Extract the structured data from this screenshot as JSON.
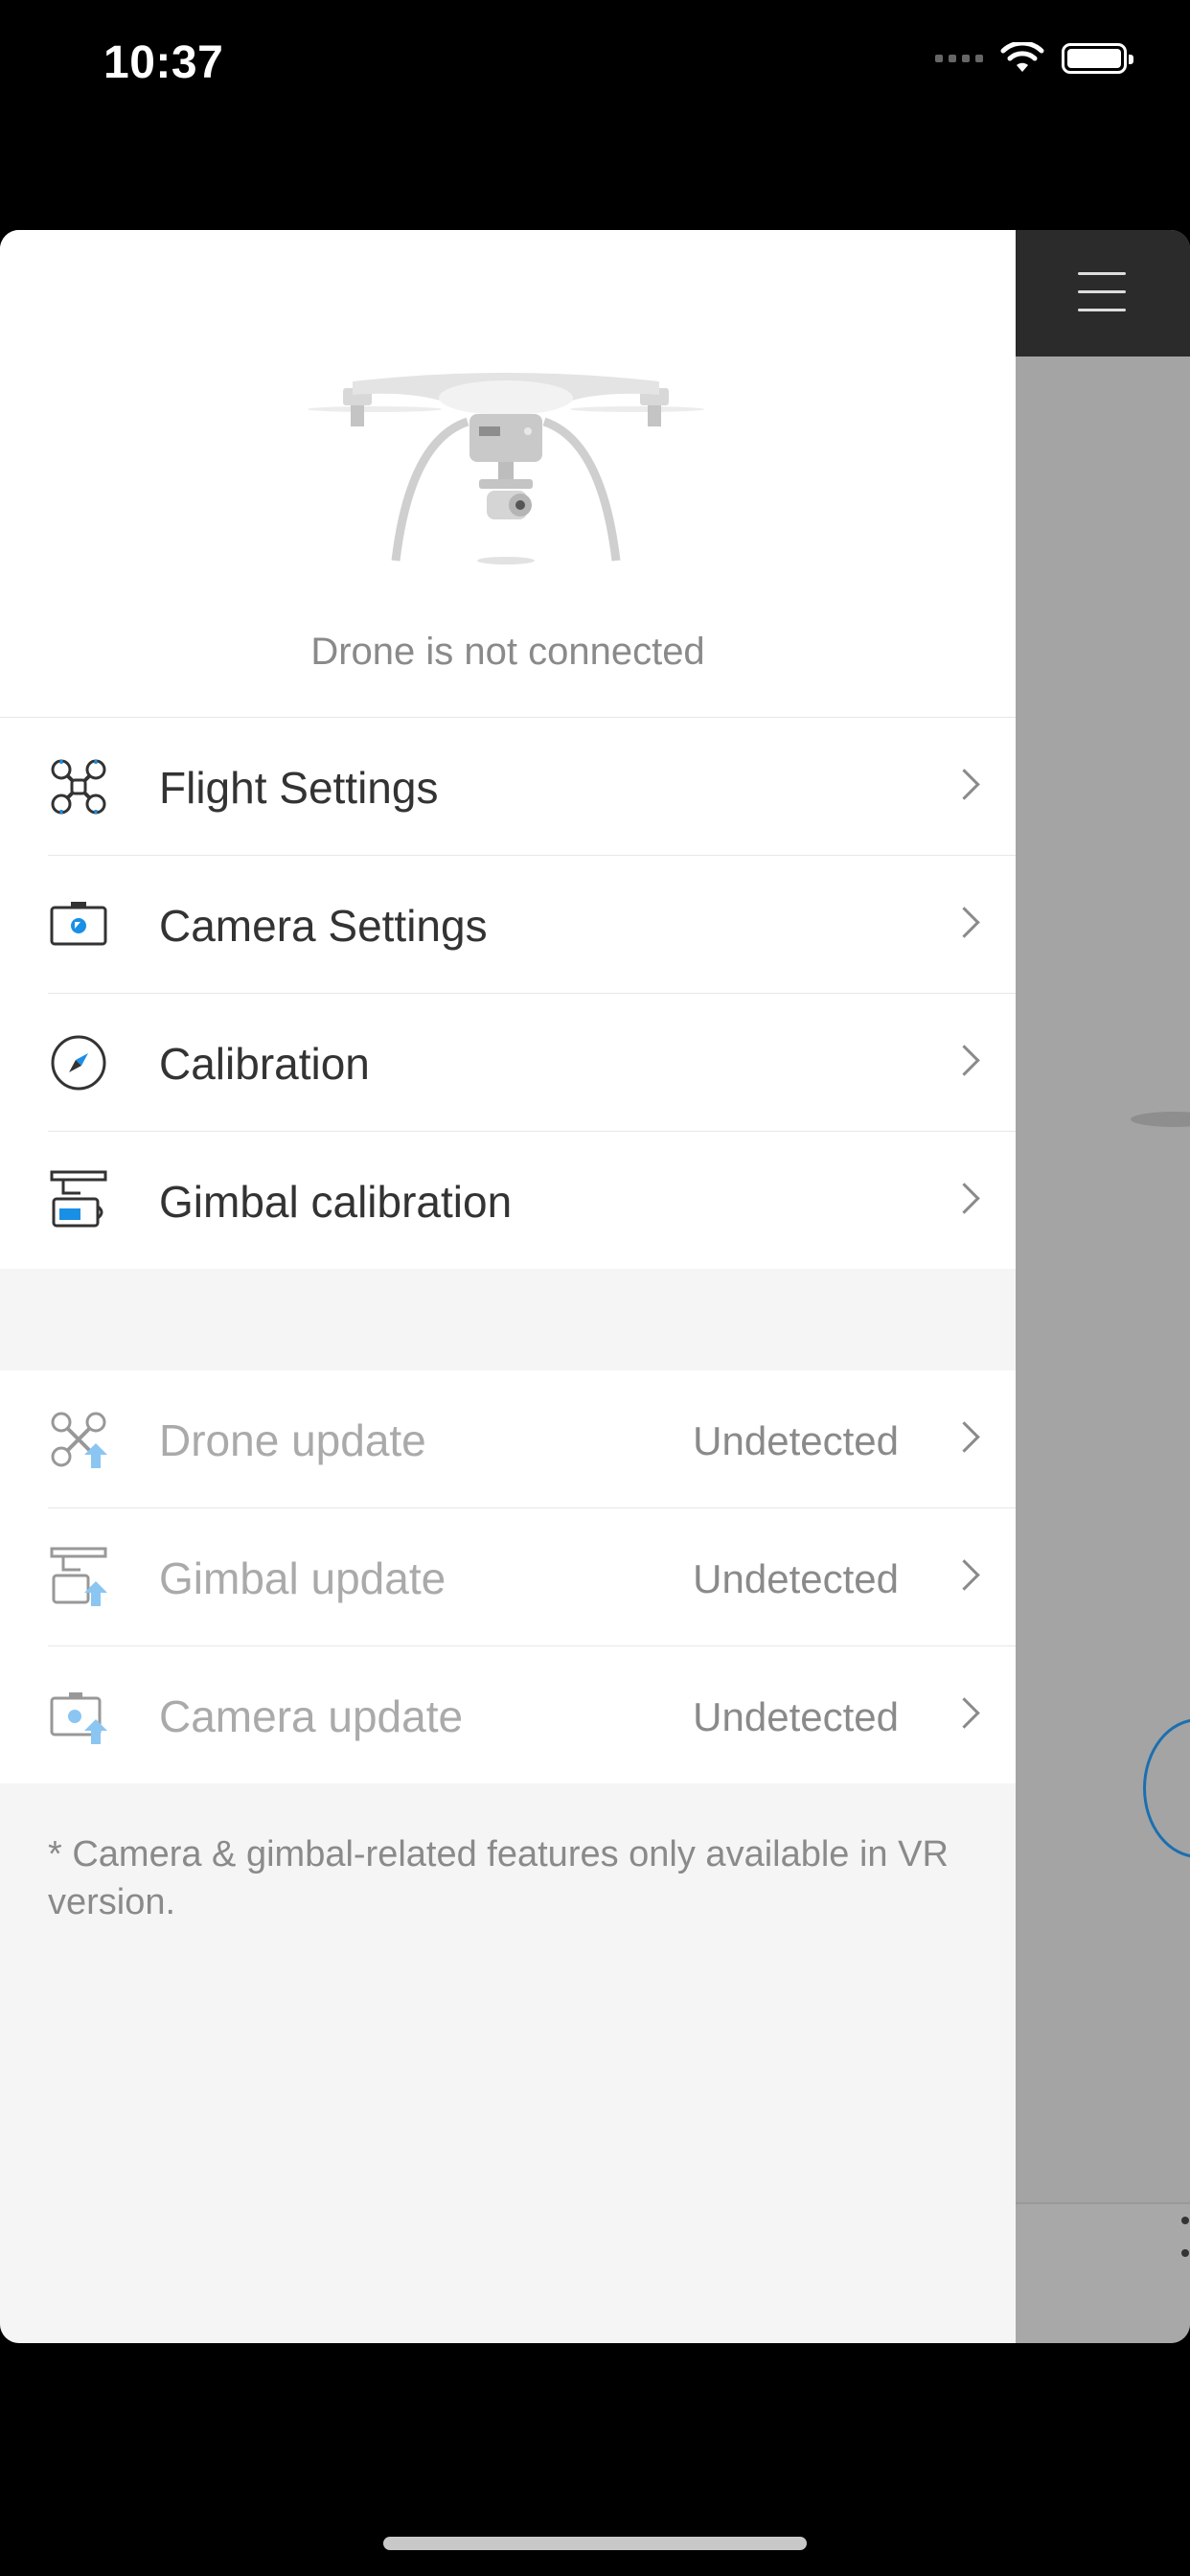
{
  "status_bar": {
    "time": "10:37",
    "battery": "full"
  },
  "header": {
    "connection_status": "Drone is not connected"
  },
  "settings_items": [
    {
      "label": "Flight Settings",
      "icon": "drone-icon"
    },
    {
      "label": "Camera Settings",
      "icon": "camera-icon"
    },
    {
      "label": "Calibration",
      "icon": "compass-icon"
    },
    {
      "label": "Gimbal calibration",
      "icon": "gimbal-icon"
    }
  ],
  "update_items": [
    {
      "label": "Drone update",
      "value": "Undetected",
      "icon": "drone-update-icon"
    },
    {
      "label": "Gimbal update",
      "value": "Undetected",
      "icon": "gimbal-update-icon"
    },
    {
      "label": "Camera update",
      "value": "Undetected",
      "icon": "camera-update-icon"
    }
  ],
  "footnote": "* Camera & gimbal-related features only available in VR version.",
  "colors": {
    "accent": "#1a8fe6",
    "dark_header": "#2b2b2b",
    "icon_dark": "#333333"
  }
}
